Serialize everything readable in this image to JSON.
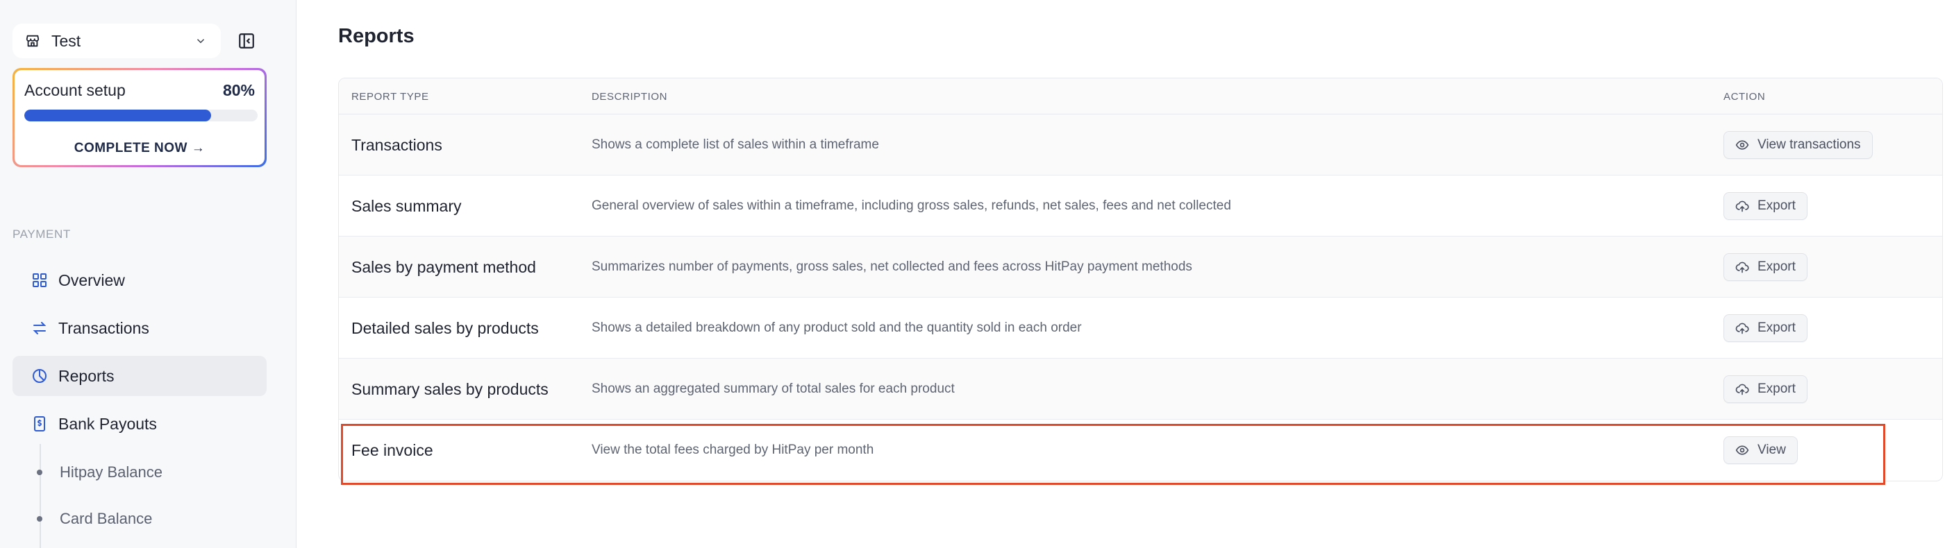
{
  "sidebar": {
    "store": {
      "name": "Test",
      "icon": "store-icon",
      "chevron": "chevron-down-icon"
    },
    "collapse_icon": "sidebar-collapse-icon",
    "account_setup": {
      "title": "Account setup",
      "percent_label": "80%",
      "progress": 0.8,
      "cta": "COMPLETE NOW →"
    },
    "section_label": "PAYMENT",
    "items": [
      {
        "label": "Overview",
        "icon": "grid-icon",
        "active": false
      },
      {
        "label": "Transactions",
        "icon": "swap-arrows-icon",
        "active": false
      },
      {
        "label": "Reports",
        "icon": "pie-chart-icon",
        "active": true
      },
      {
        "label": "Bank Payouts",
        "icon": "bank-dollar-icon",
        "active": false
      }
    ],
    "sub_items": [
      {
        "label": "Hitpay Balance"
      },
      {
        "label": "Card Balance"
      }
    ]
  },
  "main": {
    "title": "Reports",
    "columns": {
      "type": "REPORT TYPE",
      "description": "DESCRIPTION",
      "action": "ACTION"
    },
    "rows": [
      {
        "type": "Transactions",
        "description": "Shows a complete list of sales within a timeframe",
        "action": "View transactions",
        "action_icon": "eye-icon"
      },
      {
        "type": "Sales summary",
        "description": "General overview of sales within a timeframe, including gross sales, refunds, net sales, fees and net collected",
        "action": "Export",
        "action_icon": "cloud-upload-icon"
      },
      {
        "type": "Sales by payment method",
        "description": "Summarizes number of payments, gross sales, net collected and fees across HitPay payment methods",
        "action": "Export",
        "action_icon": "cloud-upload-icon"
      },
      {
        "type": "Detailed sales by products",
        "description": "Shows a detailed breakdown of any product sold and the quantity sold in each order",
        "action": "Export",
        "action_icon": "cloud-upload-icon"
      },
      {
        "type": "Summary sales by products",
        "description": "Shows an aggregated summary of total sales for each product",
        "action": "Export",
        "action_icon": "cloud-upload-icon"
      },
      {
        "type": "Fee invoice",
        "description": "View the total fees charged by HitPay per month",
        "action": "View",
        "action_icon": "eye-icon"
      }
    ]
  },
  "colors": {
    "accent": "#2f5bd4",
    "highlight": "#e1492b",
    "text": "#1f2330",
    "muted": "#5e6472"
  }
}
